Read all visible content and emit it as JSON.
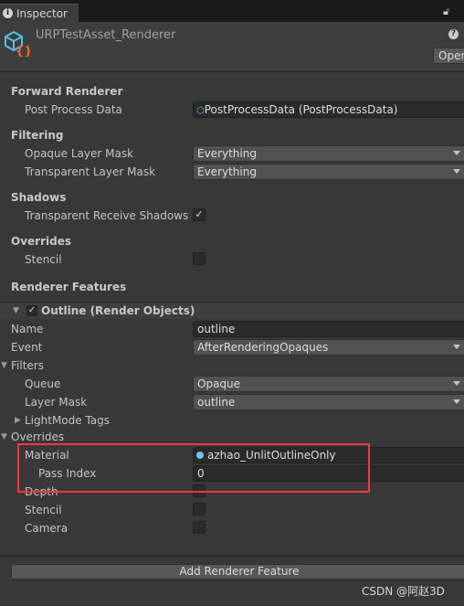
{
  "tab": {
    "label": "Inspector"
  },
  "header": {
    "title": "URPTestAsset_Renderer",
    "open_button": "Open"
  },
  "forward_renderer": {
    "title": "Forward Renderer",
    "post_process_label": "Post Process Data",
    "post_process_value": "PostProcessData (PostProcessData)"
  },
  "filtering": {
    "title": "Filtering",
    "opaque_label": "Opaque Layer Mask",
    "opaque_value": "Everything",
    "transparent_label": "Transparent Layer Mask",
    "transparent_value": "Everything"
  },
  "shadows": {
    "title": "Shadows",
    "receive_label": "Transparent Receive Shadows",
    "receive_checked": true
  },
  "overrides": {
    "title": "Overrides",
    "stencil_label": "Stencil",
    "stencil_checked": false
  },
  "renderer_features": {
    "title": "Renderer Features"
  },
  "feature": {
    "title": "Outline (Render Objects)",
    "enabled": true,
    "name_label": "Name",
    "name_value": "outline",
    "event_label": "Event",
    "event_value": "AfterRenderingOpaques",
    "filters_label": "Filters",
    "queue_label": "Queue",
    "queue_value": "Opaque",
    "layer_mask_label": "Layer Mask",
    "layer_mask_value": "outline",
    "lightmode_label": "LightMode Tags",
    "overrides_label": "Overrides",
    "material_label": "Material",
    "material_value": "azhao_UnlitOutlineOnly",
    "pass_index_label": "Pass Index",
    "pass_index_value": "0",
    "depth_label": "Depth",
    "stencil_label": "Stencil",
    "camera_label": "Camera"
  },
  "add_button": "Add Renderer Feature",
  "watermark": "CSDN @阿赵3D",
  "colors": {
    "highlight": "#f03a3a",
    "background": "#383838"
  }
}
